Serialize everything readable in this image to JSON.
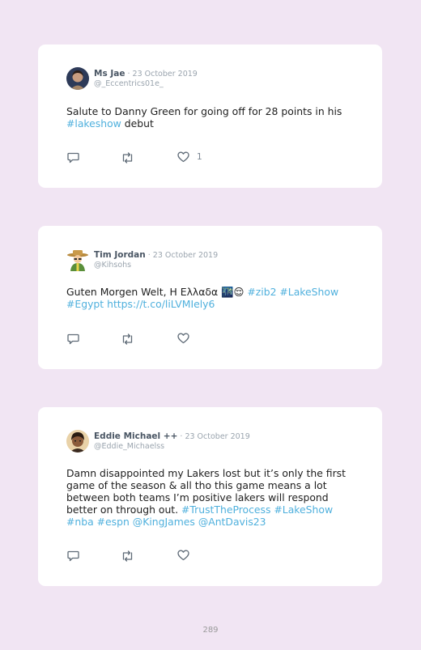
{
  "tweets": [
    {
      "name": "Ms Jae",
      "date": " · 23 October 2019",
      "handle": "@_Eccentrics01e_",
      "text_parts": [
        {
          "t": "Salute to Danny Green for going off for 28 points in his ",
          "link": false
        },
        {
          "t": "#lakeshow",
          "link": true
        },
        {
          "t": " debut",
          "link": false
        }
      ],
      "likes": "1"
    },
    {
      "name": "Tim Jordan",
      "date": " · 23 October 2019",
      "handle": "@Kihsohs",
      "text_parts": [
        {
          "t": "Guten Morgen Welt, Η Ελλαδα 🌃😌 ",
          "link": false
        },
        {
          "t": "#zib2",
          "link": true
        },
        {
          "t": " ",
          "link": false
        },
        {
          "t": "#LakeShow",
          "link": true
        },
        {
          "t": " ",
          "link": false
        },
        {
          "t": "#Egypt",
          "link": true
        },
        {
          "t": " ",
          "link": false
        },
        {
          "t": "https://t.co/liLVMIely6",
          "link": true
        }
      ],
      "likes": ""
    },
    {
      "name": "Eddie Michael ++",
      "date": " · 23 October 2019",
      "handle": "@Eddie_Michaelss",
      "text_parts": [
        {
          "t": "Damn disappointed my Lakers lost but it’s only the first game of the season & all tho this game means a lot between both teams I’m positive lakers will respond better on through out. ",
          "link": false
        },
        {
          "t": "#TrustTheProcess",
          "link": true
        },
        {
          "t": " ",
          "link": false
        },
        {
          "t": "#LakeShow",
          "link": true
        },
        {
          "t": " ",
          "link": false
        },
        {
          "t": "#nba",
          "link": true
        },
        {
          "t": " ",
          "link": false
        },
        {
          "t": "#espn",
          "link": true
        },
        {
          "t": " ",
          "link": false
        },
        {
          "t": "@KingJames",
          "link": true
        },
        {
          "t": " ",
          "link": false
        },
        {
          "t": "@AntDavis23",
          "link": true
        }
      ],
      "likes": ""
    }
  ],
  "page_number": "289",
  "colors": {
    "background": "#f1e5f3",
    "card": "#ffffff",
    "link": "#4fb0dd",
    "name": "#4a5664",
    "muted": "#9aa4ae"
  },
  "icons": [
    "reply-icon",
    "retweet-icon",
    "heart-icon"
  ]
}
